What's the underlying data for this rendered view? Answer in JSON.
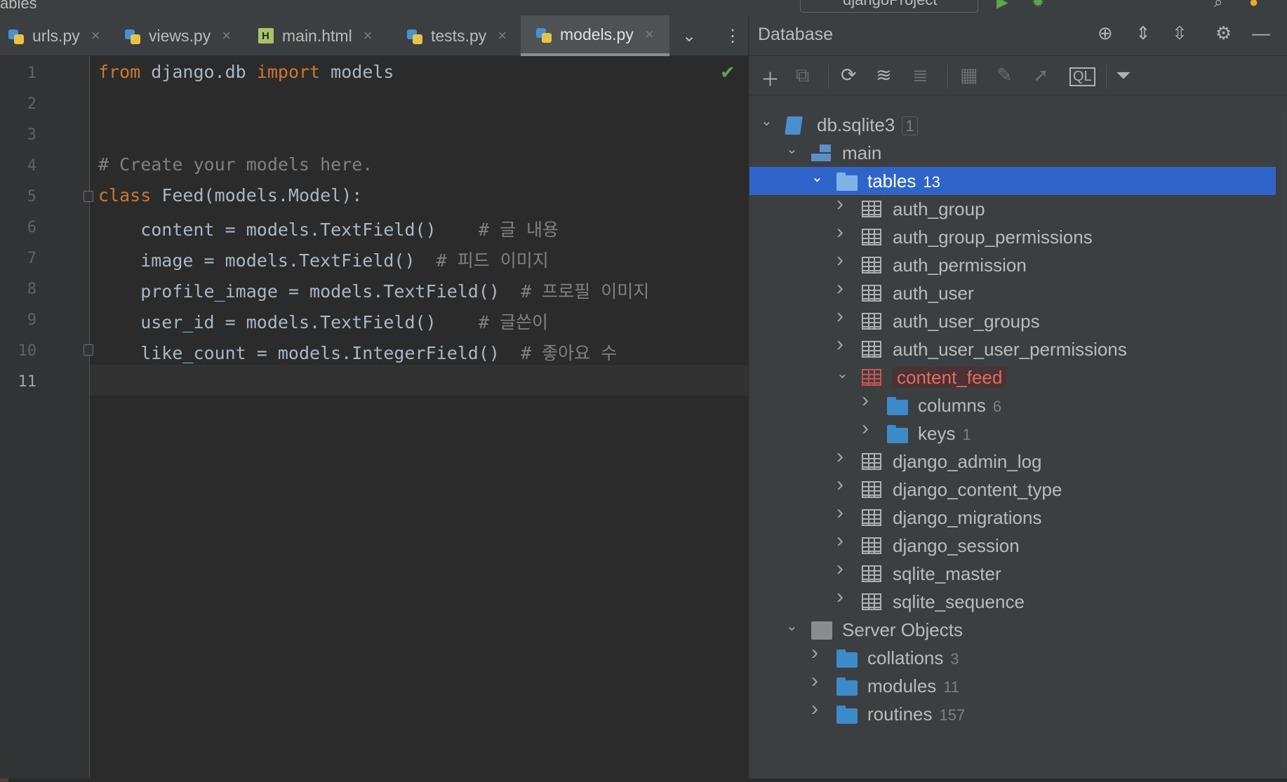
{
  "window": {
    "breadcrumb": "ables",
    "run_config": "djangoProject"
  },
  "tabs": [
    {
      "label": "urls.py",
      "icon": "python-file-icon"
    },
    {
      "label": "views.py",
      "icon": "python-file-icon"
    },
    {
      "label": "main.html",
      "icon": "html-file-icon"
    },
    {
      "label": "tests.py",
      "icon": "python-file-icon"
    },
    {
      "label": "models.py",
      "icon": "python-file-icon",
      "active": true
    }
  ],
  "editor": {
    "file": "models.py",
    "current_line": 11,
    "lines": [
      {
        "n": "1",
        "segments": [
          {
            "t": "from",
            "c": "kw"
          },
          {
            "t": " django.db ",
            "c": "plain"
          },
          {
            "t": "import",
            "c": "kw"
          },
          {
            "t": " models",
            "c": "plain"
          }
        ]
      },
      {
        "n": "2",
        "segments": []
      },
      {
        "n": "3",
        "segments": []
      },
      {
        "n": "4",
        "segments": [
          {
            "t": "# Create your models here.",
            "c": "cm"
          }
        ]
      },
      {
        "n": "5",
        "segments": [
          {
            "t": "class",
            "c": "kw"
          },
          {
            "t": " Feed(models.Model):",
            "c": "plain"
          }
        ]
      },
      {
        "n": "6",
        "segments": [
          {
            "t": "    content = models.TextField()    ",
            "c": "plain"
          },
          {
            "t": "# 글 내용",
            "c": "cm"
          }
        ]
      },
      {
        "n": "7",
        "segments": [
          {
            "t": "    image = models.TextField()  ",
            "c": "plain"
          },
          {
            "t": "# 피드 이미지",
            "c": "cm"
          }
        ]
      },
      {
        "n": "8",
        "segments": [
          {
            "t": "    profile_image = models.TextField()  ",
            "c": "plain"
          },
          {
            "t": "# 프로필 이미지",
            "c": "cm"
          }
        ]
      },
      {
        "n": "9",
        "segments": [
          {
            "t": "    user_id = models.TextField()    ",
            "c": "plain"
          },
          {
            "t": "# 글쓴이",
            "c": "cm"
          }
        ]
      },
      {
        "n": "10",
        "segments": [
          {
            "t": "    like_count = models.IntegerField()  ",
            "c": "plain"
          },
          {
            "t": "# 좋아요 수",
            "c": "cm"
          }
        ]
      },
      {
        "n": "11",
        "segments": []
      }
    ]
  },
  "database": {
    "title": "Database",
    "tree": [
      {
        "depth": 0,
        "expanded": true,
        "icon": "sqlite-db-icon",
        "label": "db.sqlite3",
        "count": "1",
        "boxed": true
      },
      {
        "depth": 1,
        "expanded": true,
        "icon": "schema-icon",
        "label": "main"
      },
      {
        "depth": 2,
        "expanded": true,
        "icon": "folder-icon",
        "label": "tables",
        "count": "13",
        "selected": true
      },
      {
        "depth": 3,
        "expanded": false,
        "icon": "table-icon",
        "label": "auth_group"
      },
      {
        "depth": 3,
        "expanded": false,
        "icon": "table-icon",
        "label": "auth_group_permissions"
      },
      {
        "depth": 3,
        "expanded": false,
        "icon": "table-icon",
        "label": "auth_permission"
      },
      {
        "depth": 3,
        "expanded": false,
        "icon": "table-icon",
        "label": "auth_user"
      },
      {
        "depth": 3,
        "expanded": false,
        "icon": "table-icon",
        "label": "auth_user_groups"
      },
      {
        "depth": 3,
        "expanded": false,
        "icon": "table-icon",
        "label": "auth_user_user_permissions"
      },
      {
        "depth": 3,
        "expanded": true,
        "icon": "table-icon",
        "label": "content_feed",
        "error": true
      },
      {
        "depth": 4,
        "expanded": false,
        "icon": "folder-icon",
        "label": "columns",
        "count": "6"
      },
      {
        "depth": 4,
        "expanded": false,
        "icon": "folder-icon",
        "label": "keys",
        "count": "1"
      },
      {
        "depth": 3,
        "expanded": false,
        "icon": "table-icon",
        "label": "django_admin_log"
      },
      {
        "depth": 3,
        "expanded": false,
        "icon": "table-icon",
        "label": "django_content_type"
      },
      {
        "depth": 3,
        "expanded": false,
        "icon": "table-icon",
        "label": "django_migrations"
      },
      {
        "depth": 3,
        "expanded": false,
        "icon": "table-icon",
        "label": "django_session"
      },
      {
        "depth": 3,
        "expanded": false,
        "icon": "table-icon",
        "label": "sqlite_master"
      },
      {
        "depth": 3,
        "expanded": false,
        "icon": "table-icon",
        "label": "sqlite_sequence"
      },
      {
        "depth": 1,
        "expanded": true,
        "icon": "server-objects-icon",
        "label": "Server Objects"
      },
      {
        "depth": 2,
        "expanded": false,
        "icon": "folder-icon",
        "label": "collations",
        "count": "3"
      },
      {
        "depth": 2,
        "expanded": false,
        "icon": "folder-icon",
        "label": "modules",
        "count": "11"
      },
      {
        "depth": 2,
        "expanded": false,
        "icon": "folder-icon",
        "label": "routines",
        "count": "157"
      }
    ]
  },
  "colors": {
    "keyword": "#cc7832",
    "comment": "#808080",
    "selection": "#2f65ca",
    "error": "#c75450",
    "folder": "#3d8ac9"
  }
}
